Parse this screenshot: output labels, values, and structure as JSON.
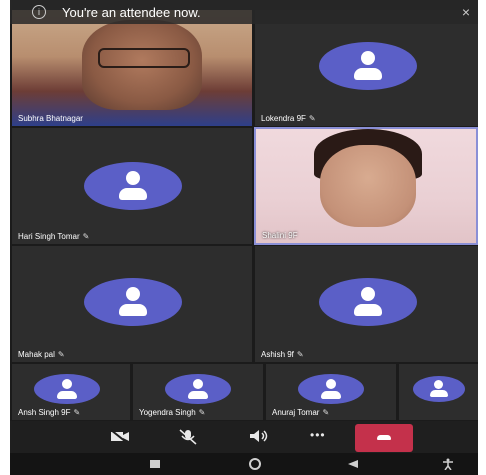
{
  "banner": {
    "text": "You're an attendee now.",
    "info_icon": "i",
    "close_icon": "×"
  },
  "participants": [
    {
      "name": "Subhra Bhatnagar",
      "muted": false,
      "video": true
    },
    {
      "name": "Lokendra 9F",
      "muted": true,
      "video": false
    },
    {
      "name": "Hari Singh Tomar",
      "muted": true,
      "video": false
    },
    {
      "name": "Shalini 9F",
      "muted": false,
      "video": true
    },
    {
      "name": "Mahak pal",
      "muted": true,
      "video": false
    },
    {
      "name": "Ashish 9f",
      "muted": true,
      "video": false
    },
    {
      "name": "Ansh Singh 9F",
      "muted": true,
      "video": false
    },
    {
      "name": "Yogendra Singh",
      "muted": true,
      "video": false
    },
    {
      "name": "Anuraj Tomar",
      "muted": true,
      "video": false
    }
  ],
  "mic_muted_glyph": "✎",
  "controls": {
    "camera_icon": "camera-off-icon",
    "mic_icon": "mic-off-icon",
    "speaker_icon": "speaker-icon",
    "more_glyph": "•••",
    "hangup_icon": "phone-hangup-icon"
  },
  "colors": {
    "avatar": "#5b5fc7",
    "hangup": "#c4314b",
    "active_border": "#8a8fd6"
  }
}
